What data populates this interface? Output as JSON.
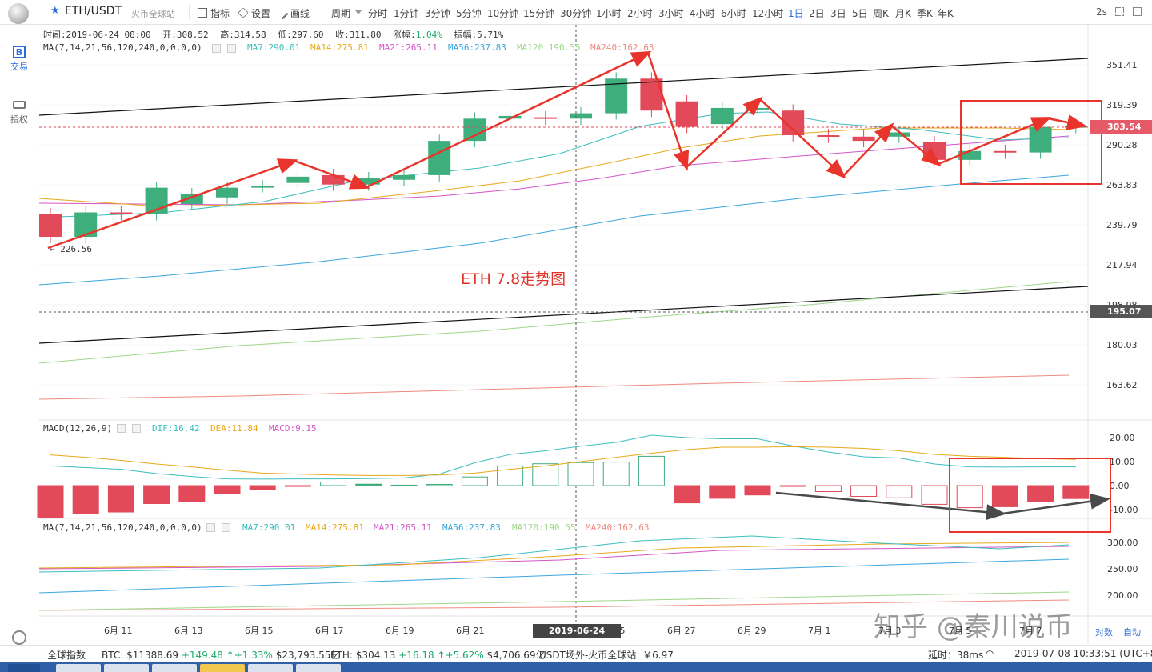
{
  "toolbar": {
    "pair": "ETH/USDT",
    "pair_sub": "火币全球站",
    "indicators_label": "指标",
    "settings_label": "设置",
    "draw_label": "画线",
    "period_label": "周期",
    "periods": [
      "分时",
      "1分钟",
      "3分钟",
      "5分钟",
      "10分钟",
      "15分钟",
      "30分钟",
      "1小时",
      "2小时",
      "3小时",
      "4小时",
      "6小时",
      "12小时",
      "1日",
      "2日",
      "3日",
      "5日",
      "周K",
      "月K",
      "季K",
      "年K"
    ],
    "active_period": "1日",
    "refresh_interval": "2s"
  },
  "sidebar": {
    "trade_label": "交易",
    "auth_label": "授权"
  },
  "info_bar": {
    "time": "时间:2019-06-24 08:00",
    "open": "开:308.52",
    "high": "高:314.58",
    "low": "低:297.60",
    "close": "收:311.80",
    "change_label": "涨幅:",
    "change_value": "1.04%",
    "amplitude_label": "振幅:",
    "amplitude_value": "5.71%"
  },
  "main_ma": {
    "title": "MA(7,14,21,56,120,240,0,0,0,0)",
    "ma7": "MA7:290.01",
    "ma14": "MA14:275.81",
    "ma21": "MA21:265.11",
    "ma56": "MA56:237.83",
    "ma120": "MA120:190.55",
    "ma240": "MA240:162.63"
  },
  "macd_info": {
    "title": "MACD(12,26,9)",
    "dif": "DIF:16.42",
    "dea": "DEA:11.84",
    "macd": "MACD:9.15"
  },
  "vol_ma": {
    "title": "MA(7,14,21,56,120,240,0,0,0,0)",
    "ma7": "MA7:290.01",
    "ma14": "MA14:275.81",
    "ma21": "MA21:265.11",
    "ma56": "MA56:237.83",
    "ma120": "MA120:190.55",
    "ma240": "MA240:162.63"
  },
  "colors": {
    "up": "#3fae7d",
    "down": "#e24a5a",
    "ma7": "#3cbdbd",
    "ma14": "#e8a81a",
    "ma21": "#d454c8",
    "ma56": "#3aa6dd",
    "ma120": "#9fd68a",
    "ma240": "#ef8a80",
    "annotation": "#e8342a"
  },
  "annotation_title": "ETH 7.8走势图",
  "low_marker": "← 226.56",
  "price_axis": [
    "351.41",
    "319.39",
    "290.28",
    "263.83",
    "239.79",
    "217.94",
    "198.08",
    "180.03",
    "163.62"
  ],
  "last_price_tag": "303.54",
  "crosshair_price_tag": "195.07",
  "macd_axis": [
    "20.00",
    "10.00",
    "0.00",
    "-10.00"
  ],
  "vol_axis": [
    "300.00",
    "250.00",
    "200.00"
  ],
  "date_axis": [
    "6月 11",
    "6月 13",
    "6月 15",
    "6月 17",
    "6月 19",
    "6月 21",
    "6月 25",
    "6月 27",
    "6月 29",
    "7月 1",
    "7月 3",
    "7月 5",
    "7月 7"
  ],
  "crosshair_time": "2019-06-24 08:00:00",
  "log_label": "对数",
  "auto_label": "自动",
  "watermark": "知乎 @秦川说币",
  "chart_data": {
    "type": "candlestick",
    "categories": [
      "6/10",
      "6/11",
      "6/12",
      "6/13",
      "6/14",
      "6/15",
      "6/16",
      "6/17",
      "6/18",
      "6/19",
      "6/20",
      "6/21",
      "6/22",
      "6/23",
      "6/24",
      "6/25",
      "6/26",
      "6/27",
      "6/28",
      "6/29",
      "6/30",
      "7/1",
      "7/2",
      "7/3",
      "7/4",
      "7/5",
      "7/6",
      "7/7",
      "7/8",
      "7/9"
    ],
    "open": [
      246,
      233,
      247,
      246,
      252,
      256,
      263,
      265,
      270,
      264,
      267,
      270,
      293,
      309,
      310,
      309,
      313,
      340,
      322,
      305,
      317,
      315,
      297,
      296,
      296,
      292,
      280,
      286,
      285,
      303
    ],
    "close": [
      233,
      247,
      246,
      262,
      258,
      262,
      263,
      269,
      264,
      268,
      270,
      293,
      309,
      311,
      309,
      313,
      340,
      315,
      303,
      317,
      317,
      297,
      296,
      293,
      299,
      280,
      286,
      285,
      303,
      303.54
    ],
    "ylim": [
      163.62,
      351.41
    ],
    "macd_hist": [
      -13.5,
      -11.5,
      -11,
      -7.5,
      -6.5,
      -3.5,
      -1.5,
      -0.2,
      1.5,
      0.6,
      0.2,
      0.5,
      3.6,
      8.2,
      9.1,
      9.6,
      9.8,
      12.2,
      -7.2,
      -5.3,
      -3.9,
      -0.2,
      -2.5,
      -4.5,
      -5.1,
      -7.8,
      -9.2,
      -8.8,
      -6.5,
      -5.4
    ],
    "dif": [
      8.2,
      7.5,
      6.8,
      5,
      3.8,
      2.8,
      2.7,
      2.8,
      2.8,
      2.9,
      3.2,
      4.8,
      9.5,
      13,
      14.5,
      16.4,
      18,
      21,
      20,
      19.5,
      19.5,
      16.5,
      14,
      12,
      11.5,
      9,
      7.8,
      7.7,
      7.8,
      7.8
    ],
    "dea": [
      12.8,
      11.8,
      10.5,
      9,
      7.8,
      6.4,
      5.2,
      4.8,
      4.4,
      4.2,
      4.2,
      4.4,
      5.2,
      6.8,
      8.2,
      10,
      11.8,
      13.5,
      15,
      16,
      16,
      16.2,
      16,
      15.5,
      14.5,
      13,
      12.2,
      11.8,
      11.2,
      10.9
    ]
  }
}
